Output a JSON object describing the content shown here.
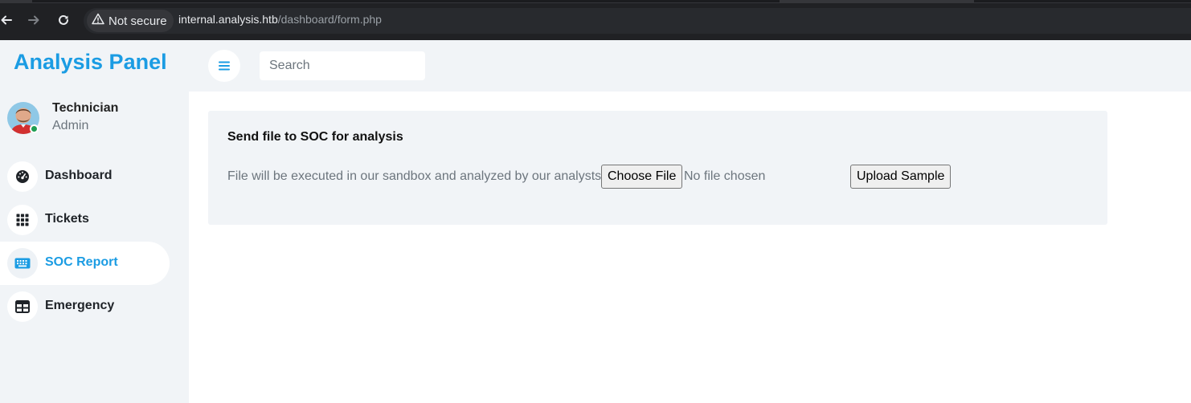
{
  "browser": {
    "security_label": "Not secure",
    "url_host": "internal.analysis.htb",
    "url_path": "/dashboard/form.php"
  },
  "sidebar": {
    "brand": "Analysis Panel",
    "profile": {
      "name": "Technician",
      "role": "Admin",
      "status": "online"
    },
    "items": [
      {
        "label": "Dashboard",
        "icon": "gauge-icon",
        "active": false
      },
      {
        "label": "Tickets",
        "icon": "grid-icon",
        "active": false
      },
      {
        "label": "SOC Report",
        "icon": "keyboard-icon",
        "active": true
      },
      {
        "label": "Emergency",
        "icon": "table-icon",
        "active": false
      }
    ]
  },
  "header": {
    "menu_icon": "hamburger-icon",
    "search_placeholder": "Search"
  },
  "form": {
    "title": "Send file to SOC for analysis",
    "help_text": "File will be executed in our sandbox and analyzed by our analysts",
    "choose_file_label": "Choose File",
    "no_file_text": "No file chosen",
    "upload_label": "Upload Sample"
  },
  "colors": {
    "accent": "#1b9ce3",
    "sidebar_bg": "#f1f4f7",
    "browser_bg": "#202124",
    "online": "#1e9e53"
  }
}
